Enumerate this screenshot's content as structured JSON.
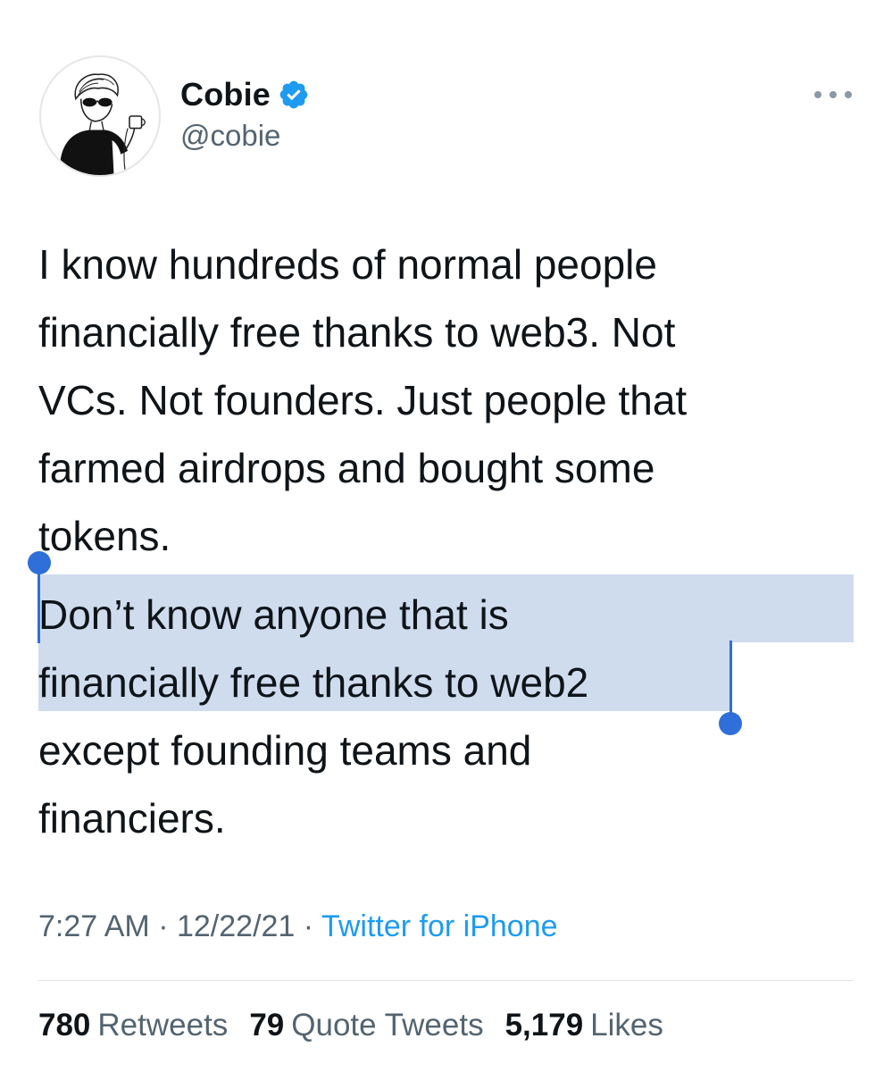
{
  "user": {
    "display_name": "Cobie",
    "handle": "@cobie",
    "verified_icon": "verified-badge-icon",
    "verified_color": "#1d9bf0"
  },
  "tweet": {
    "lines": [
      "I know hundreds of normal people",
      "financially free thanks to web3. Not",
      "VCs. Not founders. Just people that",
      "farmed airdrops and bought some",
      "tokens.",
      "Don’t know anyone that is",
      "financially free thanks to web2",
      "except founding teams and",
      "financiers."
    ],
    "selection_color": "#cfdcee",
    "selection_handle_color": "#2f6fd9"
  },
  "meta": {
    "time": "7:27 AM",
    "separator": "·",
    "date": "12/22/21",
    "source": "Twitter for iPhone"
  },
  "stats": {
    "retweets_count": "780",
    "retweets_label": "Retweets",
    "quotes_count": "79",
    "quotes_label": "Quote Tweets",
    "likes_count": "5,179",
    "likes_label": "Likes"
  }
}
